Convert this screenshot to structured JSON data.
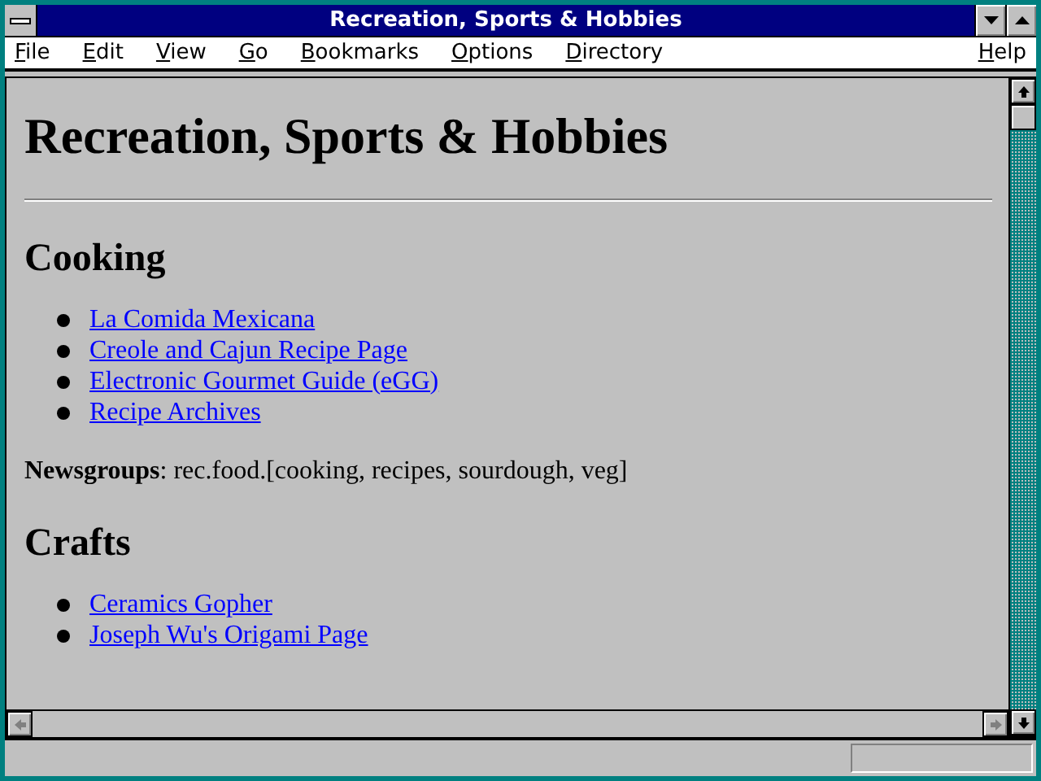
{
  "window": {
    "title": "Recreation, Sports & Hobbies"
  },
  "menu": [
    "File",
    "Edit",
    "View",
    "Go",
    "Bookmarks",
    "Options",
    "Directory"
  ],
  "help_menu": "Help",
  "page": {
    "title": "Recreation, Sports & Hobbies",
    "sections": [
      {
        "heading": "Cooking",
        "links": [
          "La Comida Mexicana",
          "Creole and Cajun Recipe Page",
          "Electronic Gourmet Guide (eGG)",
          "Recipe Archives"
        ],
        "note": "**Newsgroups**: rec.food.[cooking, recipes, sourdough, veg]"
      },
      {
        "heading": "Crafts",
        "links": [
          "Ceramics Gopher",
          "Joseph Wu's Origami Page"
        ]
      }
    ]
  }
}
